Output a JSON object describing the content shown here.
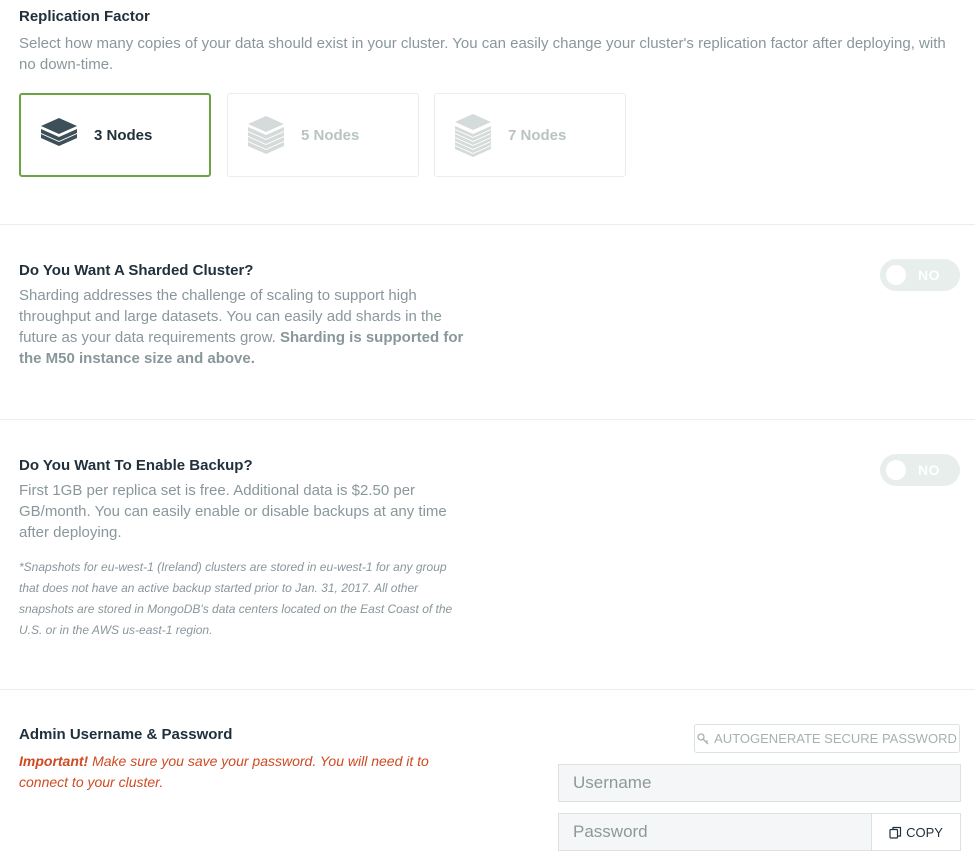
{
  "replication": {
    "title": "Replication Factor",
    "description": "Select how many copies of your data should exist in your cluster. You can easily change your cluster's replication factor after deploying, with no down-time.",
    "options": [
      {
        "label": "3 Nodes",
        "icon": "stack-3-icon",
        "selected": true
      },
      {
        "label": "5 Nodes",
        "icon": "stack-5-icon",
        "selected": false
      },
      {
        "label": "7 Nodes",
        "icon": "stack-7-icon",
        "selected": false
      }
    ],
    "selected_color": "#6ba442"
  },
  "sharding": {
    "title": "Do You Want A Sharded Cluster?",
    "description": "Sharding addresses the challenge of scaling to support high throughput and large datasets. You can easily add shards in the future as your data requirements grow.",
    "description_bold": "Sharding is supported for the M50 instance size and above.",
    "toggle_label": "NO"
  },
  "backup": {
    "title": "Do You Want To Enable Backup?",
    "description": "First 1GB per replica set is free. Additional data is $2.50 per GB/month. You can easily enable or disable backups at any time after deploying.",
    "note": "*Snapshots for eu-west-1 (Ireland) clusters are stored in eu-west-1 for any group that does not have an active backup started prior to Jan. 31, 2017. All other snapshots are stored in MongoDB's data centers located on the East Coast of the U.S. or in the AWS us-east-1 region.",
    "toggle_label": "NO"
  },
  "admin": {
    "title": "Admin Username & Password",
    "important_label": "Important!",
    "important_text": "Make sure you save your password. You will need it to connect to your cluster.",
    "autogen_label": "AUTOGENERATE SECURE PASSWORD",
    "username_placeholder": "Username",
    "password_placeholder": "Password",
    "copy_label": "COPY",
    "important_color": "#cf4a22"
  }
}
